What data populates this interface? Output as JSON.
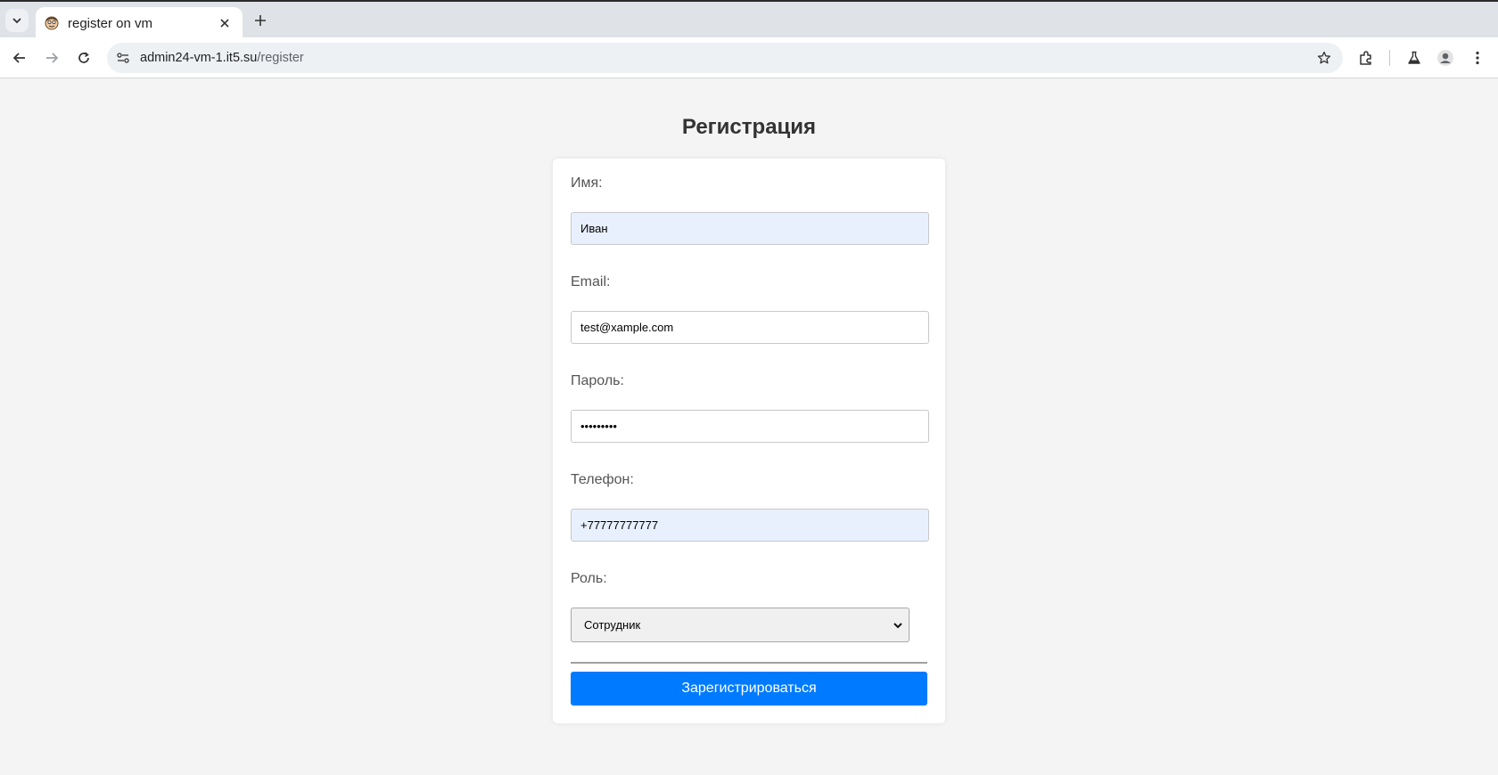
{
  "browser": {
    "tab_title": "register on vm",
    "url_host": "admin24-vm-1.it5.su",
    "url_path": "/register"
  },
  "page": {
    "title": "Регистрация"
  },
  "form": {
    "name_label": "Имя:",
    "name_value": "Иван",
    "email_label": "Email:",
    "email_value": "test@xample.com",
    "password_label": "Пароль:",
    "password_value": "•••••••••",
    "phone_label": "Телефон:",
    "phone_value": "+77777777777",
    "role_label": "Роль:",
    "role_value": "Сотрудник",
    "submit_label": "Зарегистрироваться"
  },
  "colors": {
    "accent": "#007bff",
    "autofill": "#e8f0fe",
    "page_bg": "#f4f4f4"
  },
  "icons": [
    "chevron-down-icon",
    "favicon-icon",
    "close-icon",
    "plus-icon",
    "back-icon",
    "forward-icon",
    "reload-icon",
    "site-info-icon",
    "star-icon",
    "extensions-icon",
    "labs-icon",
    "profile-icon",
    "menu-icon"
  ]
}
